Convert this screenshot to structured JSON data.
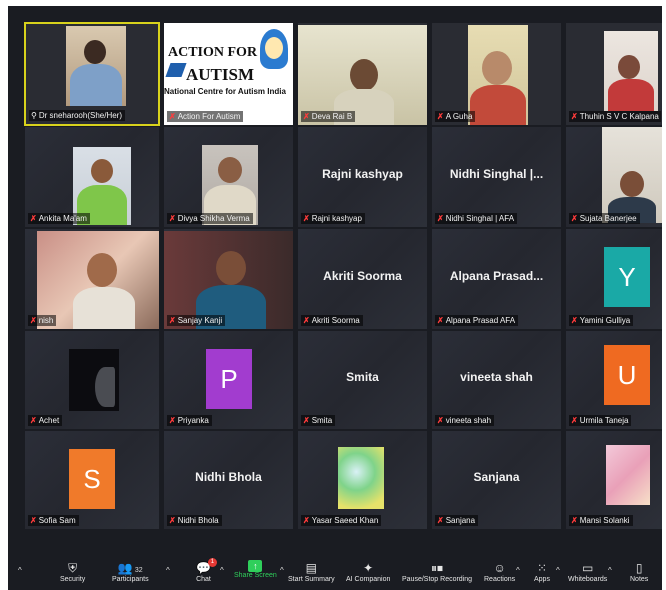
{
  "participants": [
    {
      "name": "Dr sneharooh(She/Her)",
      "pinned": true,
      "muted": false
    },
    {
      "name": "Action For Autism",
      "muted": true,
      "logo_lines": [
        "ACTION FOR",
        "AUTISM",
        "National Centre for Autism India"
      ]
    },
    {
      "name": "Deva Rai B",
      "muted": true
    },
    {
      "name": "A Guha",
      "muted": true
    },
    {
      "name": "Thuhin S V C Kalpana",
      "muted": true
    },
    {
      "name": "Ankita Ma'am",
      "muted": true
    },
    {
      "name": "Divya Shikha Verma",
      "muted": true
    },
    {
      "name": "Rajni kashyap",
      "muted": true,
      "display": "Rajni kashyap"
    },
    {
      "name": "Nidhi Singhal | AFA",
      "muted": true,
      "display": "Nidhi Singhal |..."
    },
    {
      "name": "Sujata Banerjee",
      "muted": true
    },
    {
      "name": "nish",
      "muted": true
    },
    {
      "name": "Sanjay Kanji",
      "muted": true
    },
    {
      "name": "Akriti Soorma",
      "muted": true,
      "display": "Akriti Soorma"
    },
    {
      "name": "Alpana Prasad AFA",
      "muted": true,
      "display": "Alpana Prasad..."
    },
    {
      "name": "Yamini Gulliya",
      "muted": true,
      "avatar": "Y",
      "avatar_color": "#1aa9a6"
    },
    {
      "name": "Achet",
      "muted": true
    },
    {
      "name": "Priyanka",
      "muted": true,
      "avatar": "P",
      "avatar_color": "#a23ccf"
    },
    {
      "name": "Smita",
      "muted": true,
      "display": "Smita"
    },
    {
      "name": "vineeta shah",
      "muted": true,
      "display": "vineeta shah"
    },
    {
      "name": "Urmila Taneja",
      "muted": true,
      "avatar": "U",
      "avatar_color": "#ef6a21"
    },
    {
      "name": "Sofia Sam",
      "muted": true,
      "avatar": "S",
      "avatar_color": "#f07a2a"
    },
    {
      "name": "Nidhi Bhola",
      "muted": true,
      "display": "Nidhi Bhola"
    },
    {
      "name": "Yasar Saeed Khan",
      "muted": true
    },
    {
      "name": "Sanjana",
      "muted": true,
      "display": "Sanjana"
    },
    {
      "name": "Mansi Solanki",
      "muted": true
    }
  ],
  "toolbar": {
    "security": "Security",
    "participants": "Participants",
    "participants_count": "32",
    "chat": "Chat",
    "chat_badge": "1",
    "share_screen": "Share Screen",
    "start_summary": "Start Summary",
    "ai_companion": "AI Companion",
    "pause_recording": "Pause/Stop Recording",
    "reactions": "Reactions",
    "apps": "Apps",
    "whiteboards": "Whiteboards",
    "notes": "Notes"
  },
  "colors": {
    "active_speaker_border": "#d8d21c",
    "muted_icon": "#ff3b3b",
    "share_screen_green": "#2fcf5b"
  }
}
